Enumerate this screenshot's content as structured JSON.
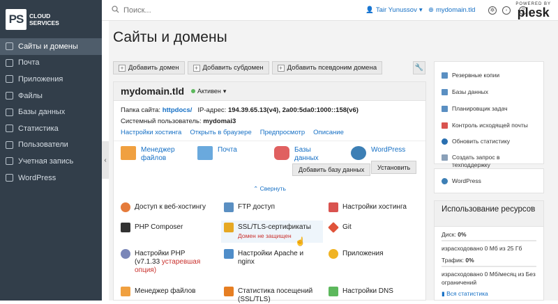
{
  "brand": {
    "logo_mark": "PS",
    "logo_line1": "CLOUD",
    "logo_line2": "SERVICES"
  },
  "sidebar": {
    "items": [
      {
        "label": "Сайты и домены",
        "icon": "monitor-icon",
        "active": true
      },
      {
        "label": "Почта",
        "icon": "mail-icon"
      },
      {
        "label": "Приложения",
        "icon": "apps-icon"
      },
      {
        "label": "Файлы",
        "icon": "folder-icon"
      },
      {
        "label": "Базы данных",
        "icon": "database-icon"
      },
      {
        "label": "Статистика",
        "icon": "stats-icon"
      },
      {
        "label": "Пользователи",
        "icon": "user-icon"
      },
      {
        "label": "Учетная запись",
        "icon": "account-icon"
      },
      {
        "label": "WordPress",
        "icon": "wordpress-icon"
      }
    ],
    "collapse_glyph": "‹"
  },
  "topbar": {
    "search_placeholder": "Поиск...",
    "user": "Tair Yunussov",
    "domain": "mydomain.tld",
    "powered_by": "POWERED BY",
    "plesk": "plesk"
  },
  "page": {
    "title": "Сайты и домены"
  },
  "toolbar": {
    "add_domain": "Добавить домен",
    "add_subdomain": "Добавить субдомен",
    "add_alias": "Добавить псевдоним домена"
  },
  "domain": {
    "name": "mydomain.tld",
    "status": "Активен",
    "folder_label": "Папка сайта:",
    "folder": "httpdocs/",
    "ip_label": "IP-адрес:",
    "ip": "194.39.65.13(v4), 2a00:5da0:1000::158(v6)",
    "user_label": "Системный пользователь:",
    "user": "mydomai3",
    "links": [
      "Настройки хостинга",
      "Открыть в браузере",
      "Предпросмотр",
      "Описание"
    ],
    "apps": {
      "file_manager": "Менеджер файлов",
      "mail": "Почта",
      "databases": "Базы данных",
      "wordpress": "WordPress",
      "add_db_button": "Добавить базу данных",
      "install_button": "Установить"
    },
    "collapse": "⌃ Свернуть",
    "tools": [
      {
        "label": "Доступ к веб-хостингу",
        "color": "#e57b3b"
      },
      {
        "label": "FTP доступ",
        "color": "#5a8fc2"
      },
      {
        "label": "Настройки хостинга",
        "color": "#d9534f"
      },
      {
        "label": "PHP Composer",
        "color": "#333333"
      },
      {
        "label": "SSL/TLS-сертификаты",
        "warning": "Домен не защищен",
        "color": "#e6a823"
      },
      {
        "label": "Git",
        "color": "#e0533a"
      },
      {
        "label": "Настройки PHP",
        "sub": "(v7.1.33 ",
        "sub_warn": "устаревшая",
        "sub2": "опция)",
        "color": "#7a86b8"
      },
      {
        "label": "Настройки Apache и nginx",
        "color": "#4f8dc9"
      },
      {
        "label": "Приложения",
        "color": "#f0b323"
      },
      {
        "label": "Менеджер файлов",
        "color": "#f0a040"
      },
      {
        "label": "Статистика посещений (SSL/TLS)",
        "color": "#e67e22"
      },
      {
        "label": "Настройки DNS",
        "color": "#5cb85c"
      }
    ]
  },
  "right_panel": {
    "items": [
      {
        "label": "Резервные копии",
        "color": "#5a8fc2"
      },
      {
        "label": "Базы данных",
        "color": "#5a8fc2"
      },
      {
        "label": "Планировщик задач",
        "color": "#5a8fc2"
      },
      {
        "label": "Контроль исходящей почты",
        "color": "#d9534f"
      },
      {
        "label": "Обновить статистику",
        "color": "#2a6fb0"
      },
      {
        "label": "Создать запрос в техподдержку",
        "color": "#8aa0b8"
      }
    ],
    "wordpress": "WordPress",
    "usage": {
      "title": "Использование ресурсов",
      "disk_label": "Диск:",
      "disk_value": "0%",
      "disk_detail": "израсходовано 0 Мб из 25 Гб",
      "traffic_label": "Трафик:",
      "traffic_value": "0%",
      "traffic_detail": "израсходовано 0 Мб/месяц из Без ограничений",
      "all_stats": "Вся статистика"
    }
  }
}
